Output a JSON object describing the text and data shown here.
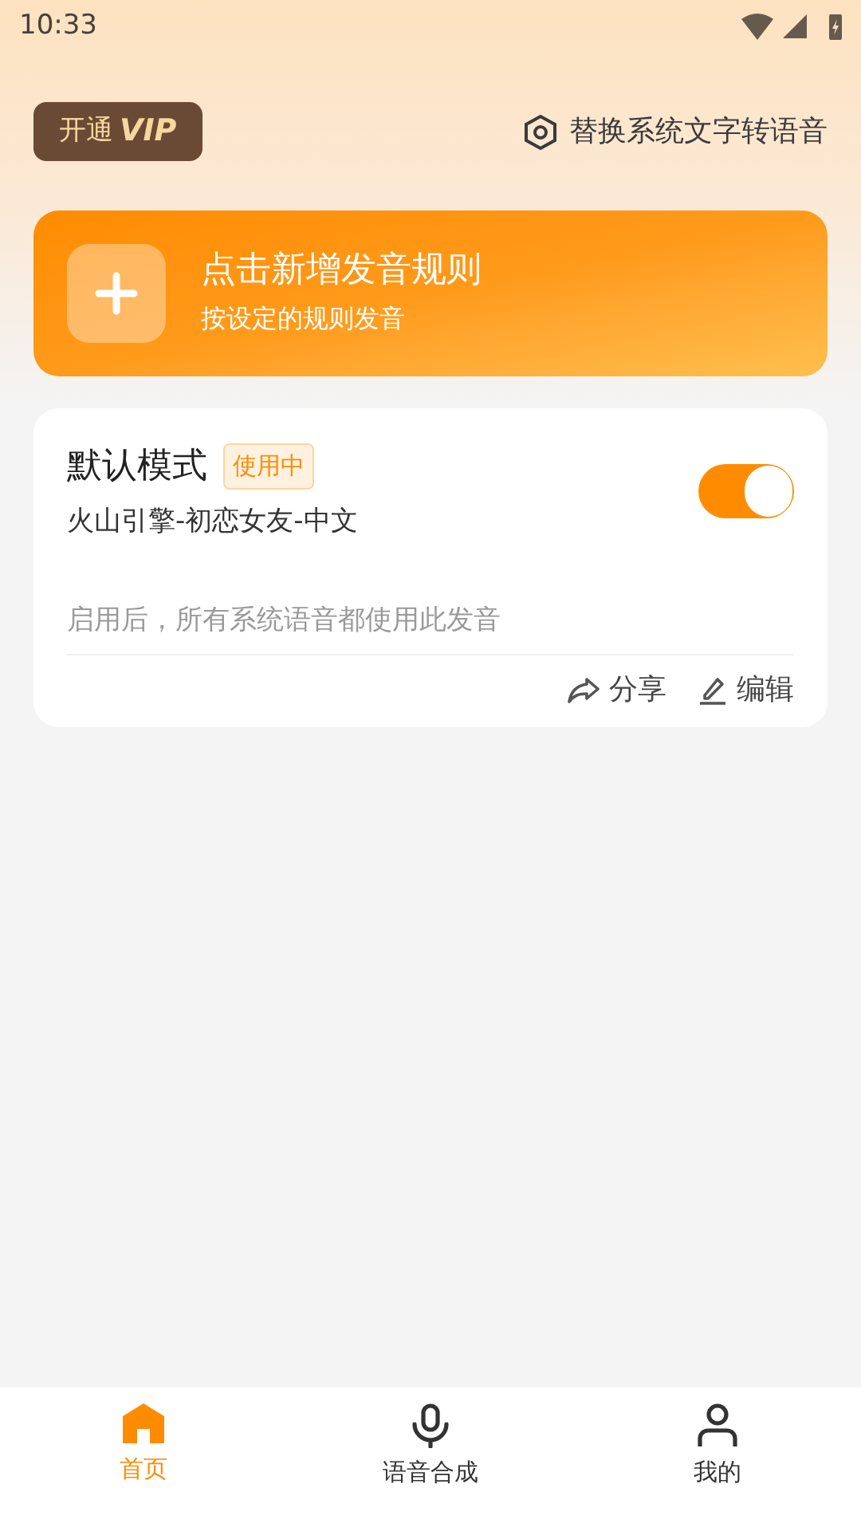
{
  "status_bar": {
    "time": "10:33"
  },
  "header": {
    "vip_button": {
      "prefix": "开通",
      "vip": "VIP"
    },
    "replace_link": "替换系统文字转语音"
  },
  "add_card": {
    "title": "点击新增发音规则",
    "subtitle": "按设定的规则发音"
  },
  "rule_card": {
    "name": "默认模式",
    "badge": "使用中",
    "voice": "火山引擎-初恋女友-中文",
    "on": true,
    "description": "启用后，所有系统语音都使用此发音",
    "actions": [
      {
        "kind": "share",
        "label": "分享"
      },
      {
        "kind": "edit",
        "label": "编辑"
      }
    ]
  },
  "tabs": [
    {
      "kind": "home",
      "label": "首页",
      "selected": true
    },
    {
      "kind": "mic",
      "label": "语音合成",
      "selected": false
    },
    {
      "kind": "user",
      "label": "我的",
      "selected": false
    }
  ]
}
